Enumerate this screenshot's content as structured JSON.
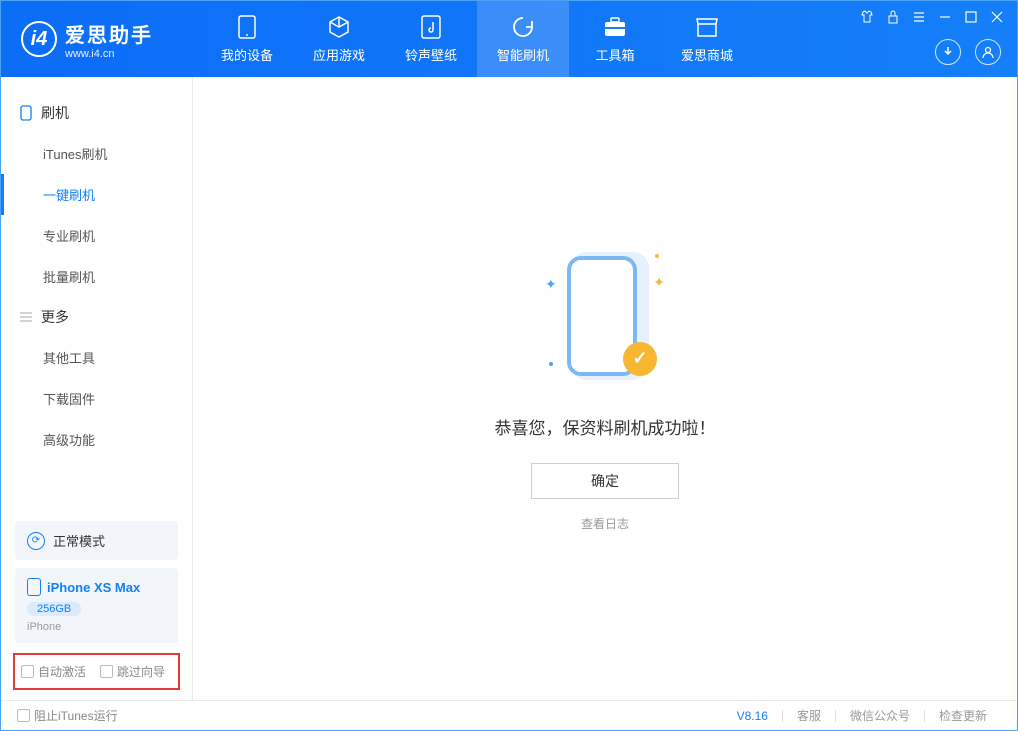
{
  "app": {
    "title": "爱思助手",
    "subtitle": "www.i4.cn"
  },
  "nav": {
    "tabs": [
      {
        "label": "我的设备"
      },
      {
        "label": "应用游戏"
      },
      {
        "label": "铃声壁纸"
      },
      {
        "label": "智能刷机"
      },
      {
        "label": "工具箱"
      },
      {
        "label": "爱思商城"
      }
    ]
  },
  "sidebar": {
    "sections": [
      {
        "title": "刷机",
        "items": [
          {
            "label": "iTunes刷机"
          },
          {
            "label": "一键刷机"
          },
          {
            "label": "专业刷机"
          },
          {
            "label": "批量刷机"
          }
        ]
      },
      {
        "title": "更多",
        "items": [
          {
            "label": "其他工具"
          },
          {
            "label": "下载固件"
          },
          {
            "label": "高级功能"
          }
        ]
      }
    ],
    "mode": "正常模式",
    "device": {
      "name": "iPhone XS Max",
      "storage": "256GB",
      "type": "iPhone"
    },
    "checkboxes": {
      "auto_activate": "自动激活",
      "skip_guide": "跳过向导"
    }
  },
  "main": {
    "success_message": "恭喜您，保资料刷机成功啦！",
    "ok_button": "确定",
    "view_log": "查看日志"
  },
  "footer": {
    "block_itunes": "阻止iTunes运行",
    "version": "V8.16",
    "links": {
      "support": "客服",
      "wechat": "微信公众号",
      "update": "检查更新"
    }
  }
}
